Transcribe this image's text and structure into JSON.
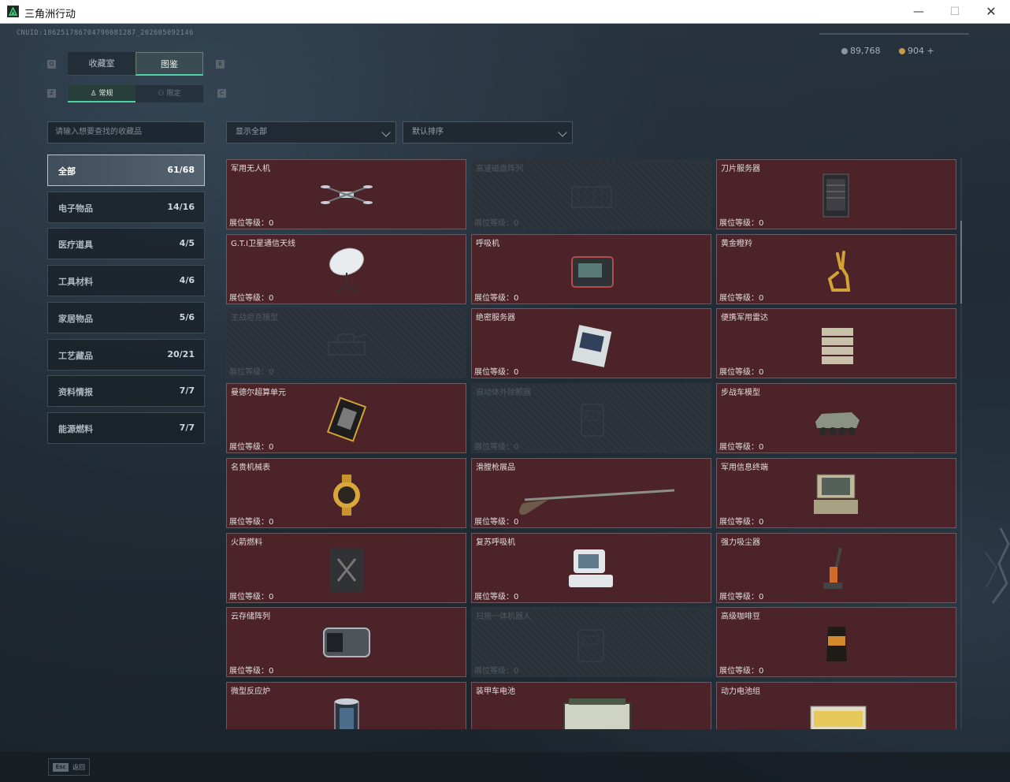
{
  "window": {
    "title": "三角洲行动",
    "min": "—",
    "max": "☐",
    "close": "✕"
  },
  "uid": "CNUID:186251786704790081287_202605092146",
  "currency": {
    "silver": "89,768",
    "gold": "904 +"
  },
  "keys": {
    "prev_tab": "Q",
    "next_tab": "E",
    "prev_sub": "Z",
    "next_sub": "C"
  },
  "tabs": [
    "收藏室",
    "图鉴"
  ],
  "subtabs": [
    "常规",
    "限定"
  ],
  "search": {
    "placeholder": "请输入想要查找的收藏品"
  },
  "filters": {
    "show": "显示全部",
    "sort": "默认排序"
  },
  "categories": [
    {
      "label": "全部",
      "count": "61/68"
    },
    {
      "label": "电子物品",
      "count": "14/16"
    },
    {
      "label": "医疗道具",
      "count": "4/5"
    },
    {
      "label": "工具材料",
      "count": "4/6"
    },
    {
      "label": "家居物品",
      "count": "5/6"
    },
    {
      "label": "工艺藏品",
      "count": "20/21"
    },
    {
      "label": "资料情报",
      "count": "7/7"
    },
    {
      "label": "能源燃料",
      "count": "7/7"
    }
  ],
  "items": [
    {
      "name": "军用无人机",
      "level": "展位等级：0",
      "icon": "drone-icon",
      "locked": false
    },
    {
      "name": "高速磁盘阵列",
      "level": "展位等级：0",
      "icon": "disk-array-icon",
      "locked": true
    },
    {
      "name": "刀片服务器",
      "level": "展位等级：0",
      "icon": "blade-server-icon",
      "locked": false
    },
    {
      "name": "G.T.I卫星通信天线",
      "level": "展位等级：0",
      "icon": "satellite-dish-icon",
      "locked": false
    },
    {
      "name": "呼吸机",
      "level": "展位等级：0",
      "icon": "ventilator-icon",
      "locked": false
    },
    {
      "name": "黄金瞪羚",
      "level": "展位等级：0",
      "icon": "gold-gazelle-icon",
      "locked": false
    },
    {
      "name": "主战坦克模型",
      "level": "展位等级：0",
      "icon": "tank-model-icon",
      "locked": true
    },
    {
      "name": "绝密服务器",
      "level": "展位等级：0",
      "icon": "secret-server-icon",
      "locked": false
    },
    {
      "name": "便携军用雷达",
      "level": "展位等级：0",
      "icon": "portable-radar-icon",
      "locked": false
    },
    {
      "name": "曼德尔超算单元",
      "level": "展位等级：0",
      "icon": "supercompute-unit-icon",
      "locked": false
    },
    {
      "name": "自动体外除颤器",
      "level": "展位等级：0",
      "icon": "defibrillator-icon",
      "locked": true
    },
    {
      "name": "步战车模型",
      "level": "展位等级：0",
      "icon": "ifv-model-icon",
      "locked": false
    },
    {
      "name": "名贵机械表",
      "level": "展位等级：0",
      "icon": "luxury-watch-icon",
      "locked": false
    },
    {
      "name": "滑膛枪展品",
      "level": "展位等级：0",
      "icon": "musket-icon",
      "locked": false
    },
    {
      "name": "军用信息终端",
      "level": "展位等级：0",
      "icon": "military-terminal-icon",
      "locked": false
    },
    {
      "name": "火箭燃料",
      "level": "展位等级：0",
      "icon": "rocket-fuel-icon",
      "locked": false
    },
    {
      "name": "复苏呼吸机",
      "level": "展位等级：0",
      "icon": "resuscitator-icon",
      "locked": false
    },
    {
      "name": "强力吸尘器",
      "level": "展位等级：0",
      "icon": "vacuum-cleaner-icon",
      "locked": false
    },
    {
      "name": "云存储阵列",
      "level": "展位等级：0",
      "icon": "cloud-storage-icon",
      "locked": false
    },
    {
      "name": "扫拖一体机器人",
      "level": "展位等级：0",
      "icon": "robot-vacuum-icon",
      "locked": true
    },
    {
      "name": "高级咖啡豆",
      "level": "展位等级：0",
      "icon": "coffee-beans-icon",
      "locked": false
    },
    {
      "name": "微型反应炉",
      "level": "展位等级：0",
      "icon": "micro-reactor-icon",
      "locked": false
    },
    {
      "name": "装甲车电池",
      "level": "展位等级：0",
      "icon": "armored-battery-icon",
      "locked": false
    },
    {
      "name": "动力电池组",
      "level": "展位等级：0",
      "icon": "power-battery-icon",
      "locked": false
    }
  ],
  "footer": {
    "key": "Esc",
    "label": "返回"
  }
}
